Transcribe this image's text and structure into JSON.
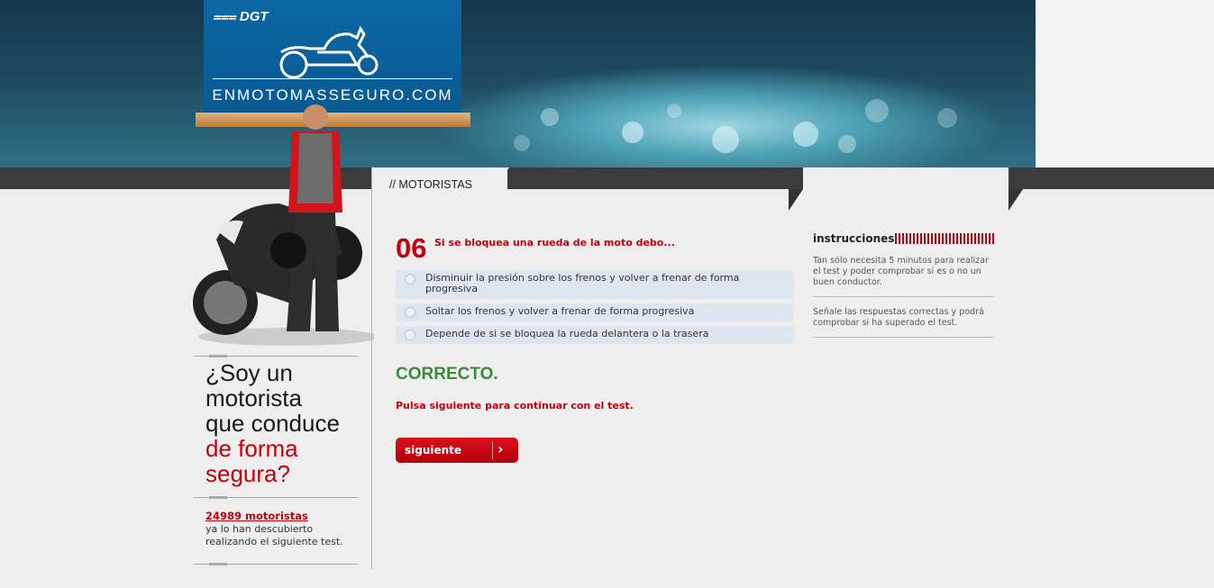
{
  "header": {
    "brand": "DGT",
    "site_name": "ENMOTOMASSEGURO.COM"
  },
  "tab": {
    "label": "// MOTORISTAS"
  },
  "question": {
    "number": "06",
    "text": "Si se bloquea una rueda de la moto debo...",
    "options": [
      {
        "label": "Disminuir la presión sobre los frenos y volver a frenar de forma progresiva"
      },
      {
        "label": "Soltar los frenos y volver a frenar de forma progresiva"
      },
      {
        "label": "Depende de si se bloquea la rueda delantera o la trasera"
      }
    ],
    "result": "CORRECTO.",
    "hint": "Pulsa siguiente para continuar con el test.",
    "next_label": "siguiente"
  },
  "sidebar": {
    "slogan_line1": "¿Soy un",
    "slogan_line2": "motorista",
    "slogan_line3": "que conduce",
    "slogan_red1": "de forma",
    "slogan_red2": "segura?",
    "stats_link": "24989 motoristas",
    "stats_text": "ya lo han descubierto realizando el siguiente test."
  },
  "instructions": {
    "title": "instrucciones",
    "p1": "Tan sólo necesita 5 minutos para realizar el test y poder comprobar si es o no un buen conductor.",
    "p2": "Señale las respuestas correctas y podrá comprobar si ha superado el test."
  },
  "colors": {
    "accent_red": "#c4000c",
    "correct_green": "#3d8a3d",
    "logo_blue": "#0b67a3"
  }
}
